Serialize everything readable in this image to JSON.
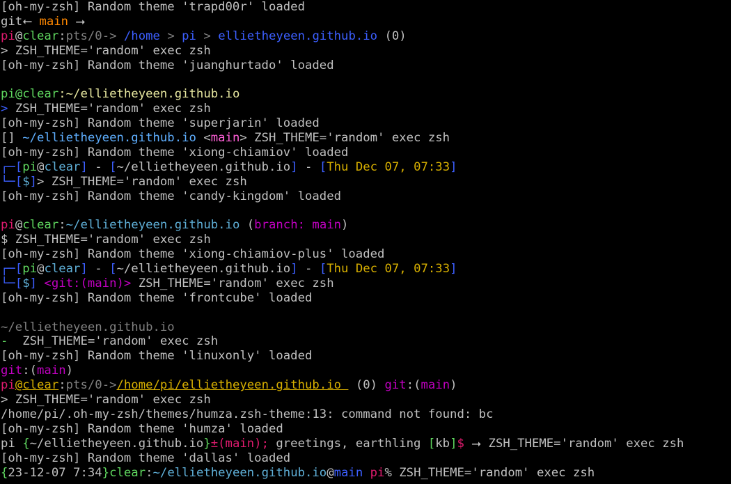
{
  "terminal": {
    "background": "#000000",
    "default_color": "#c0c0c0",
    "lines": [
      {
        "segs": [
          {
            "t": "[oh-my-zsh] Random theme 'trapd00r' loaded"
          }
        ]
      },
      {
        "segs": [
          {
            "t": "git",
            "c": "#c0c0c0"
          },
          {
            "t": "⭠ ",
            "c": "#c0c0c0"
          },
          {
            "t": "main",
            "c": "#ff8700"
          },
          {
            "t": " ⭢",
            "c": "#c0c0c0"
          }
        ]
      },
      {
        "segs": [
          {
            "t": "pi",
            "c": "#e01b6e"
          },
          {
            "t": "@",
            "c": "#c0c0c0"
          },
          {
            "t": "clear",
            "c": "#5fd75f"
          },
          {
            "t": ":",
            "c": "#c0c0c0"
          },
          {
            "t": "pts/0",
            "c": "#808080"
          },
          {
            "t": "-> ",
            "c": "#808080"
          },
          {
            "t": "/home",
            "c": "#3c5fff"
          },
          {
            "t": " > ",
            "c": "#808080"
          },
          {
            "t": "pi",
            "c": "#3c5fff"
          },
          {
            "t": " > ",
            "c": "#808080"
          },
          {
            "t": "ellietheyeen.github.io",
            "c": "#3c5fff"
          },
          {
            "t": " (0)",
            "c": "#c0c0c0"
          }
        ]
      },
      {
        "segs": [
          {
            "t": "> ZSH_THEME='random' exec zsh"
          }
        ]
      },
      {
        "segs": [
          {
            "t": "[oh-my-zsh] Random theme 'juanghurtado' loaded"
          }
        ]
      },
      {
        "segs": [
          {
            "t": ""
          }
        ]
      },
      {
        "segs": [
          {
            "t": "pi",
            "c": "#5fd75f"
          },
          {
            "t": "@",
            "c": "#5fd75f"
          },
          {
            "t": "clear",
            "c": "#5fd75f"
          },
          {
            "t": ":~/ellietheyeen.github.io",
            "c": "#e8e8a0"
          }
        ]
      },
      {
        "segs": [
          {
            "t": "> ",
            "c": "#3c5fff"
          },
          {
            "t": "ZSH_THEME='random' exec zsh"
          }
        ]
      },
      {
        "segs": [
          {
            "t": "[oh-my-zsh] Random theme 'superjarin' loaded"
          }
        ]
      },
      {
        "segs": [
          {
            "t": "[] ",
            "c": "#c0c0c0"
          },
          {
            "t": "~/ellietheyeen.github.io",
            "c": "#5fafff"
          },
          {
            "t": " <",
            "c": "#c0c0c0"
          },
          {
            "t": "main",
            "c": "#ff5fd7"
          },
          {
            "t": "> ZSH_THEME='random' exec zsh",
            "c": "#c0c0c0"
          }
        ]
      },
      {
        "segs": [
          {
            "t": "[oh-my-zsh] Random theme 'xiong-chiamiov' loaded"
          }
        ]
      },
      {
        "segs": [
          {
            "t": "┌─",
            "c": "#3c5fff"
          },
          {
            "t": "[",
            "c": "#3c5fff"
          },
          {
            "t": "pi",
            "c": "#5fd75f"
          },
          {
            "t": "@",
            "c": "#c0c0c0"
          },
          {
            "t": "clear",
            "c": "#5fafd7"
          },
          {
            "t": "]",
            "c": "#3c5fff"
          },
          {
            "t": " - ",
            "c": "#c0c0c0"
          },
          {
            "t": "[",
            "c": "#3c5fff"
          },
          {
            "t": "~/ellietheyeen.github.io",
            "c": "#c0c0c0"
          },
          {
            "t": "]",
            "c": "#3c5fff"
          },
          {
            "t": " - ",
            "c": "#c0c0c0"
          },
          {
            "t": "[",
            "c": "#3c5fff"
          },
          {
            "t": "Thu Dec 07, 07:33",
            "c": "#d7af00"
          },
          {
            "t": "]",
            "c": "#3c5fff"
          }
        ]
      },
      {
        "segs": [
          {
            "t": "└─",
            "c": "#3c5fff"
          },
          {
            "t": "[",
            "c": "#3c5fff"
          },
          {
            "t": "$",
            "c": "#5fafd7"
          },
          {
            "t": "]",
            "c": "#3c5fff"
          },
          {
            "t": "> ZSH_THEME='random' exec zsh",
            "c": "#c0c0c0"
          }
        ]
      },
      {
        "segs": [
          {
            "t": "[oh-my-zsh] Random theme 'candy-kingdom' loaded"
          }
        ]
      },
      {
        "segs": [
          {
            "t": ""
          }
        ]
      },
      {
        "segs": [
          {
            "t": "pi",
            "c": "#e01b6e"
          },
          {
            "t": "@",
            "c": "#c0c0c0"
          },
          {
            "t": "clear",
            "c": "#5fd75f"
          },
          {
            "t": ":",
            "c": "#c0c0c0"
          },
          {
            "t": "~/ellietheyeen.github.io",
            "c": "#5fafd7"
          },
          {
            "t": " (",
            "c": "#c0c0c0"
          },
          {
            "t": "branch:",
            "c": "#c000c0"
          },
          {
            "t": " main",
            "c": "#c000c0"
          },
          {
            "t": ")",
            "c": "#c0c0c0"
          }
        ]
      },
      {
        "segs": [
          {
            "t": "$ ZSH_THEME='random' exec zsh"
          }
        ]
      },
      {
        "segs": [
          {
            "t": "[oh-my-zsh] Random theme 'xiong-chiamiov-plus' loaded"
          }
        ]
      },
      {
        "segs": [
          {
            "t": "┌─",
            "c": "#3c5fff"
          },
          {
            "t": "[",
            "c": "#3c5fff"
          },
          {
            "t": "pi",
            "c": "#5fd75f"
          },
          {
            "t": "@",
            "c": "#c0c0c0"
          },
          {
            "t": "clear",
            "c": "#5fafd7"
          },
          {
            "t": "]",
            "c": "#3c5fff"
          },
          {
            "t": " - ",
            "c": "#c0c0c0"
          },
          {
            "t": "[",
            "c": "#3c5fff"
          },
          {
            "t": "~/ellietheyeen.github.io",
            "c": "#c0c0c0"
          },
          {
            "t": "]",
            "c": "#3c5fff"
          },
          {
            "t": " - ",
            "c": "#c0c0c0"
          },
          {
            "t": "[",
            "c": "#3c5fff"
          },
          {
            "t": "Thu Dec 07, 07:33",
            "c": "#d7af00"
          },
          {
            "t": "]",
            "c": "#3c5fff"
          }
        ]
      },
      {
        "segs": [
          {
            "t": "└─",
            "c": "#3c5fff"
          },
          {
            "t": "[",
            "c": "#3c5fff"
          },
          {
            "t": "$",
            "c": "#5fafd7"
          },
          {
            "t": "]",
            "c": "#3c5fff"
          },
          {
            "t": " <git:(main)>",
            "c": "#c000c0"
          },
          {
            "t": " ZSH_THEME='random' exec zsh",
            "c": "#c0c0c0"
          }
        ]
      },
      {
        "segs": [
          {
            "t": "[oh-my-zsh] Random theme 'frontcube' loaded"
          }
        ]
      },
      {
        "segs": [
          {
            "t": ""
          }
        ]
      },
      {
        "segs": [
          {
            "t": "~/ellietheyeen.github.io",
            "c": "#808080"
          }
        ]
      },
      {
        "segs": [
          {
            "t": "-",
            "c": "#5fd75f"
          },
          {
            "t": "  ZSH_THEME='random' exec zsh"
          }
        ]
      },
      {
        "segs": [
          {
            "t": "[oh-my-zsh] Random theme 'linuxonly' loaded"
          }
        ]
      },
      {
        "segs": [
          {
            "t": "git",
            "c": "#c000c0"
          },
          {
            "t": ":(",
            "c": "#c0c0c0"
          },
          {
            "t": "main",
            "c": "#c000c0"
          },
          {
            "t": ")",
            "c": "#c0c0c0"
          }
        ]
      },
      {
        "segs": [
          {
            "t": "pi",
            "c": "#e01b6e"
          },
          {
            "t": "@",
            "c": "#d7af00",
            "u": true
          },
          {
            "t": "clear",
            "c": "#d7af00",
            "u": true
          },
          {
            "t": ":",
            "c": "#c0c0c0"
          },
          {
            "t": "pts/0",
            "c": "#808080"
          },
          {
            "t": "->",
            "c": "#808080"
          },
          {
            "t": "/home/pi/ellietheyeen.github.io ",
            "c": "#d7af00",
            "u": true
          },
          {
            "t": " (0) ",
            "c": "#c0c0c0"
          },
          {
            "t": "git",
            "c": "#c000c0"
          },
          {
            "t": ":(",
            "c": "#c0c0c0"
          },
          {
            "t": "main",
            "c": "#c000c0"
          },
          {
            "t": ")",
            "c": "#c0c0c0"
          }
        ]
      },
      {
        "segs": [
          {
            "t": "> ZSH_THEME='random' exec zsh"
          }
        ]
      },
      {
        "segs": [
          {
            "t": "/home/pi/.oh-my-zsh/themes/humza.zsh-theme:13: command not found: bc"
          }
        ]
      },
      {
        "segs": [
          {
            "t": "[oh-my-zsh] Random theme 'humza' loaded"
          }
        ]
      },
      {
        "segs": [
          {
            "t": "pi",
            "c": "#c0c0c0"
          },
          {
            "t": " {",
            "c": "#5fd75f"
          },
          {
            "t": "~/ellietheyeen.github.io",
            "c": "#c0c0c0"
          },
          {
            "t": "}",
            "c": "#5fd75f"
          },
          {
            "t": "±(main);",
            "c": "#e01b6e"
          },
          {
            "t": " greetings, earthling ",
            "c": "#c0c0c0"
          },
          {
            "t": "[",
            "c": "#5fd75f"
          },
          {
            "t": "kb",
            "c": "#c0c0c0"
          },
          {
            "t": "]",
            "c": "#5fd75f"
          },
          {
            "t": "$",
            "c": "#e01b6e"
          },
          {
            "t": " ⭢ ZSH_THEME='random' exec zsh",
            "c": "#c0c0c0"
          }
        ]
      },
      {
        "segs": [
          {
            "t": "[oh-my-zsh] Random theme 'dallas' loaded"
          }
        ]
      },
      {
        "segs": [
          {
            "t": "{",
            "c": "#5fd75f"
          },
          {
            "t": "23-12-07 7:34",
            "c": "#c0c0c0"
          },
          {
            "t": "}",
            "c": "#5fd75f"
          },
          {
            "t": "clear",
            "c": "#5fd75f"
          },
          {
            "t": ":",
            "c": "#c0c0c0"
          },
          {
            "t": "~/ellietheyeen.github.io",
            "c": "#5fafd7"
          },
          {
            "t": "@",
            "c": "#c0c0c0"
          },
          {
            "t": "main",
            "c": "#3c5fff"
          },
          {
            "t": " pi",
            "c": "#e01b6e"
          },
          {
            "t": "% ZSH_THEME='random' exec zsh",
            "c": "#c0c0c0"
          }
        ]
      }
    ]
  }
}
